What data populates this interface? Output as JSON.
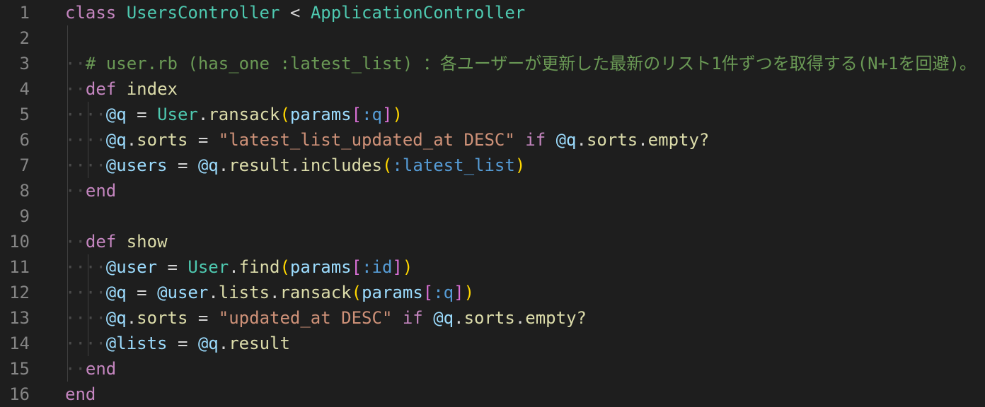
{
  "editor": {
    "language": "ruby",
    "colors": {
      "background": "#1e1e1e",
      "line_number": "#858585",
      "keyword": "#c586c0",
      "class": "#4ec9b0",
      "variable": "#9cdcfe",
      "method": "#dcdcaa",
      "string": "#ce9178",
      "symbol": "#569cd6",
      "comment": "#6a9955"
    },
    "line_numbers": [
      "1",
      "2",
      "3",
      "4",
      "5",
      "6",
      "7",
      "8",
      "9",
      "10",
      "11",
      "12",
      "13",
      "14",
      "15",
      "16"
    ],
    "lines": [
      [
        {
          "t": "class",
          "c": "kw"
        },
        {
          "t": " ",
          "c": "plain"
        },
        {
          "t": "UsersController",
          "c": "cls"
        },
        {
          "t": " < ",
          "c": "plain"
        },
        {
          "t": "ApplicationController",
          "c": "cls"
        }
      ],
      [],
      [
        {
          "t": "··",
          "c": "ws"
        },
        {
          "t": "# user.rb (has_one :latest_list) ：各ユーザーが更新した最新のリスト1件ずつを取得する(N+1を回避)。",
          "c": "cmt"
        }
      ],
      [
        {
          "t": "··",
          "c": "ws"
        },
        {
          "t": "def",
          "c": "kw"
        },
        {
          "t": " ",
          "c": "plain"
        },
        {
          "t": "index",
          "c": "meth"
        }
      ],
      [
        {
          "t": "····",
          "c": "ws"
        },
        {
          "t": "@q",
          "c": "ivar"
        },
        {
          "t": " = ",
          "c": "plain"
        },
        {
          "t": "User",
          "c": "cls"
        },
        {
          "t": ".",
          "c": "plain"
        },
        {
          "t": "ransack",
          "c": "meth"
        },
        {
          "t": "(",
          "c": "br1"
        },
        {
          "t": "params",
          "c": "var"
        },
        {
          "t": "[",
          "c": "br2"
        },
        {
          "t": ":q",
          "c": "sym"
        },
        {
          "t": "]",
          "c": "br2"
        },
        {
          "t": ")",
          "c": "br1"
        }
      ],
      [
        {
          "t": "····",
          "c": "ws"
        },
        {
          "t": "@q",
          "c": "ivar"
        },
        {
          "t": ".",
          "c": "plain"
        },
        {
          "t": "sorts",
          "c": "meth"
        },
        {
          "t": " = ",
          "c": "plain"
        },
        {
          "t": "\"latest_list_updated_at DESC\"",
          "c": "str"
        },
        {
          "t": " ",
          "c": "plain"
        },
        {
          "t": "if",
          "c": "kw"
        },
        {
          "t": " ",
          "c": "plain"
        },
        {
          "t": "@q",
          "c": "ivar"
        },
        {
          "t": ".",
          "c": "plain"
        },
        {
          "t": "sorts",
          "c": "meth"
        },
        {
          "t": ".",
          "c": "plain"
        },
        {
          "t": "empty?",
          "c": "meth"
        }
      ],
      [
        {
          "t": "····",
          "c": "ws"
        },
        {
          "t": "@users",
          "c": "ivar"
        },
        {
          "t": " = ",
          "c": "plain"
        },
        {
          "t": "@q",
          "c": "ivar"
        },
        {
          "t": ".",
          "c": "plain"
        },
        {
          "t": "result",
          "c": "meth"
        },
        {
          "t": ".",
          "c": "plain"
        },
        {
          "t": "includes",
          "c": "meth"
        },
        {
          "t": "(",
          "c": "br1"
        },
        {
          "t": ":latest_list",
          "c": "sym"
        },
        {
          "t": ")",
          "c": "br1"
        }
      ],
      [
        {
          "t": "··",
          "c": "ws"
        },
        {
          "t": "end",
          "c": "kw"
        }
      ],
      [],
      [
        {
          "t": "··",
          "c": "ws"
        },
        {
          "t": "def",
          "c": "kw"
        },
        {
          "t": " ",
          "c": "plain"
        },
        {
          "t": "show",
          "c": "meth"
        }
      ],
      [
        {
          "t": "····",
          "c": "ws"
        },
        {
          "t": "@user",
          "c": "ivar"
        },
        {
          "t": " = ",
          "c": "plain"
        },
        {
          "t": "User",
          "c": "cls"
        },
        {
          "t": ".",
          "c": "plain"
        },
        {
          "t": "find",
          "c": "meth"
        },
        {
          "t": "(",
          "c": "br1"
        },
        {
          "t": "params",
          "c": "var"
        },
        {
          "t": "[",
          "c": "br2"
        },
        {
          "t": ":id",
          "c": "sym"
        },
        {
          "t": "]",
          "c": "br2"
        },
        {
          "t": ")",
          "c": "br1"
        }
      ],
      [
        {
          "t": "····",
          "c": "ws"
        },
        {
          "t": "@q",
          "c": "ivar"
        },
        {
          "t": " = ",
          "c": "plain"
        },
        {
          "t": "@user",
          "c": "ivar"
        },
        {
          "t": ".",
          "c": "plain"
        },
        {
          "t": "lists",
          "c": "meth"
        },
        {
          "t": ".",
          "c": "plain"
        },
        {
          "t": "ransack",
          "c": "meth"
        },
        {
          "t": "(",
          "c": "br1"
        },
        {
          "t": "params",
          "c": "var"
        },
        {
          "t": "[",
          "c": "br2"
        },
        {
          "t": ":q",
          "c": "sym"
        },
        {
          "t": "]",
          "c": "br2"
        },
        {
          "t": ")",
          "c": "br1"
        }
      ],
      [
        {
          "t": "····",
          "c": "ws"
        },
        {
          "t": "@q",
          "c": "ivar"
        },
        {
          "t": ".",
          "c": "plain"
        },
        {
          "t": "sorts",
          "c": "meth"
        },
        {
          "t": " = ",
          "c": "plain"
        },
        {
          "t": "\"updated_at DESC\"",
          "c": "str"
        },
        {
          "t": " ",
          "c": "plain"
        },
        {
          "t": "if",
          "c": "kw"
        },
        {
          "t": " ",
          "c": "plain"
        },
        {
          "t": "@q",
          "c": "ivar"
        },
        {
          "t": ".",
          "c": "plain"
        },
        {
          "t": "sorts",
          "c": "meth"
        },
        {
          "t": ".",
          "c": "plain"
        },
        {
          "t": "empty?",
          "c": "meth"
        }
      ],
      [
        {
          "t": "····",
          "c": "ws"
        },
        {
          "t": "@lists",
          "c": "ivar"
        },
        {
          "t": " = ",
          "c": "plain"
        },
        {
          "t": "@q",
          "c": "ivar"
        },
        {
          "t": ".",
          "c": "plain"
        },
        {
          "t": "result",
          "c": "meth"
        }
      ],
      [
        {
          "t": "··",
          "c": "ws"
        },
        {
          "t": "end",
          "c": "kw"
        }
      ],
      [
        {
          "t": "end",
          "c": "kw"
        }
      ]
    ]
  }
}
